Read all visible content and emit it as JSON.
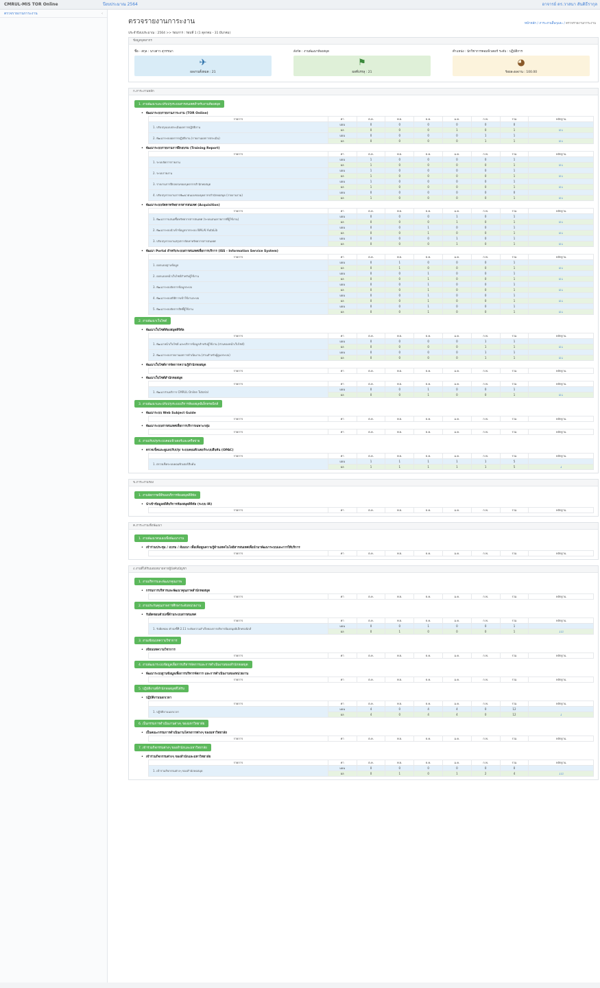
{
  "topbar": {
    "brand": "CMRUL-MIS TOR Online",
    "fiscal": "ปีงบประมาณ 2564",
    "user": "อาจารย์ ดร.วาสนา สันติธีรากุล"
  },
  "sidebar": {
    "item": "ตรวจรายงานการะงาน",
    "chevron": "‹"
  },
  "page": {
    "title": "ตรวจรายงานการะงาน",
    "crumb_home": "หน้าหลัก",
    "crumb_mid": "ภาระงานอื่นๆและ",
    "crumb_cur": "ตรวจรายงานการะงาน",
    "crumb_sep": "/"
  },
  "period": "ประจำปีงบประมาณ : 2564 >> รอบการ : รอบที่ 1 (1 ตุลาคม - 31 มีนาคม)",
  "info": {
    "header": "ข้อมูลบุคลากร",
    "name": "ชื่อ - สกุล : นางสาว สุวรรณา",
    "affiliation": "สังกัด : งานพัฒนาห้องสมุด",
    "position": "ตำแหน่ง : นักวิชาการคอมพิวเตอร์ ระดับ : ปฏิบัติการ",
    "card1": "ผลงานทั้งหมด : 21",
    "card2": "ผลที่บรรลุ : 21",
    "card3": "ร้อยละผลงาน : 100.00",
    "ic1": "✈",
    "ic2": "⚑",
    "ic3": "◕"
  },
  "cols": [
    "รายการ",
    "ค่า",
    "ต.ค.",
    "พ.ย.",
    "ธ.ค.",
    "ม.ค.",
    "ก.พ.",
    "รวม",
    "หลักฐาน"
  ],
  "row_types": {
    "plan": "แผน",
    "result": "ผล"
  },
  "groups": [
    {
      "header": "ก.ภาระงานหลัก",
      "categories": [
        {
          "title": "1. งานพัฒนาและปรับปรุงระบบสารสนเทศสำหรับงานห้องสมุด",
          "sections": [
            {
              "title": "พัฒนาระบบรายงานภาระงาน (TOR Online)",
              "items": [
                {
                  "label": "1. ปรับปรุงแบบประเมินผลการปฏิบัติงาน",
                  "plan": [
                    "0",
                    "0",
                    "0",
                    "0",
                    "0",
                    "0"
                  ],
                  "result": [
                    "0",
                    "0",
                    "0",
                    "1",
                    "0",
                    "1"
                  ],
                  "ev": "☑↓"
                },
                {
                  "label": "2. พัฒนาระบบผลการปฏิบัติงาน (รายงานผลการประเมิน)",
                  "plan": [
                    "0",
                    "0",
                    "0",
                    "0",
                    "1",
                    "1"
                  ],
                  "result": [
                    "0",
                    "0",
                    "0",
                    "0",
                    "1",
                    "1"
                  ],
                  "ev": "☑↓"
                }
              ]
            },
            {
              "title": "พัฒนาระบบรายงานการฝึกอบรม (Training Report)",
              "items": [
                {
                  "label": "1. ระบบจัดการรายงาน",
                  "plan": [
                    "1",
                    "0",
                    "0",
                    "0",
                    "0",
                    "1"
                  ],
                  "result": [
                    "1",
                    "0",
                    "0",
                    "0",
                    "0",
                    "1"
                  ],
                  "ev": "☑↓"
                },
                {
                  "label": "2. ระบบรายงาน",
                  "plan": [
                    "1",
                    "0",
                    "0",
                    "0",
                    "0",
                    "1"
                  ],
                  "result": [
                    "1",
                    "0",
                    "0",
                    "0",
                    "0",
                    "1"
                  ],
                  "ev": "☑↓"
                },
                {
                  "label": "3. รายงานการฝึกอบรมของบุคลากรสำนักหอสมุด",
                  "plan": [
                    "1",
                    "0",
                    "0",
                    "0",
                    "0",
                    "1"
                  ],
                  "result": [
                    "1",
                    "0",
                    "0",
                    "0",
                    "0",
                    "1"
                  ],
                  "ev": "☑↓"
                },
                {
                  "label": "4. ปรับปรุงรายงานการพัฒนาตนเองของบุคลากรสำนักหอสมุด (รายงานรวม)",
                  "plan": [
                    "0",
                    "0",
                    "0",
                    "0",
                    "0",
                    "0"
                  ],
                  "result": [
                    "1",
                    "0",
                    "0",
                    "0",
                    "0",
                    "1"
                  ],
                  "ev": "☑↓"
                }
              ]
            },
            {
              "title": "พัฒนาระบบจัดหาทรัพยากรสารสนเทศ (Acquisition)",
              "items": [
                {
                  "label": "1. พัฒนาการเสนอซื้อทรัพยากรสารสนเทศ (ระบบเสนอรายการที่ผู้ใช้งาน)",
                  "plan": [
                    "0",
                    "0",
                    "0",
                    "1",
                    "0",
                    "1"
                  ],
                  "result": [
                    "0",
                    "0",
                    "0",
                    "1",
                    "0",
                    "1"
                  ],
                  "ev": "☑↓"
                },
                {
                  "label": "2. พัฒนาระบบนำเข้าข้อมูลจากระบบ WALAI AutoLib",
                  "plan": [
                    "0",
                    "0",
                    "1",
                    "0",
                    "0",
                    "1"
                  ],
                  "result": [
                    "0",
                    "0",
                    "1",
                    "0",
                    "0",
                    "1"
                  ],
                  "ev": "☑↓"
                },
                {
                  "label": "3. ปรับปรุงรายงานสรุปการจัดหาทรัพยากรสารสนเทศ",
                  "plan": [
                    "0",
                    "0",
                    "0",
                    "1",
                    "0",
                    "1"
                  ],
                  "result": [
                    "0",
                    "0",
                    "0",
                    "1",
                    "0",
                    "1"
                  ],
                  "ev": "☑↓"
                }
              ]
            },
            {
              "title": "พัฒนา Portal สำหรับระบบสารสนเทศเพื่อการบริการ (ISS - Information Service System)",
              "items": [
                {
                  "label": "1. ออกแบบฐานข้อมูล",
                  "plan": [
                    "0",
                    "1",
                    "0",
                    "0",
                    "0",
                    "1"
                  ],
                  "result": [
                    "0",
                    "1",
                    "0",
                    "0",
                    "0",
                    "1"
                  ],
                  "ev": "☑↓"
                },
                {
                  "label": "2. ออกแบบหน้าเว็บไซต์สำหรับผู้ใช้งาน",
                  "plan": [
                    "0",
                    "0",
                    "1",
                    "0",
                    "0",
                    "1"
                  ],
                  "result": [
                    "0",
                    "0",
                    "1",
                    "0",
                    "0",
                    "1"
                  ],
                  "ev": "☑↓"
                },
                {
                  "label": "3. พัฒนาระบบจัดการข้อมูลระบบ",
                  "plan": [
                    "0",
                    "0",
                    "1",
                    "0",
                    "0",
                    "1"
                  ],
                  "result": [
                    "0",
                    "0",
                    "1",
                    "0",
                    "0",
                    "1"
                  ],
                  "ev": "☑↓"
                },
                {
                  "label": "4. พัฒนาระบบสถิติการเข้าใช้งานระบบ",
                  "plan": [
                    "0",
                    "0",
                    "1",
                    "0",
                    "0",
                    "1"
                  ],
                  "result": [
                    "0",
                    "0",
                    "1",
                    "0",
                    "0",
                    "1"
                  ],
                  "ev": "☑↓"
                },
                {
                  "label": "5. พัฒนาระบบจัดการสิทธิ์ผู้ใช้งาน",
                  "plan": [
                    "0",
                    "0",
                    "1",
                    "0",
                    "0",
                    "1"
                  ],
                  "result": [
                    "0",
                    "0",
                    "1",
                    "0",
                    "0",
                    "1"
                  ],
                  "ev": "☑↓"
                }
              ]
            }
          ]
        },
        {
          "title": "2. งานพัฒนาเว็บไซต์",
          "sections": [
            {
              "title": "พัฒนาเว็บไซต์ห้องสมุดดิจิทัล",
              "items": [
                {
                  "label": "1. พัฒนาหน้าเว็บไซต์ และบริการข้อมูลสำหรับผู้ใช้งาน (ส่วนของหน้าเว็บไซต์)",
                  "plan": [
                    "0",
                    "0",
                    "0",
                    "0",
                    "1",
                    "1"
                  ],
                  "result": [
                    "0",
                    "0",
                    "0",
                    "0",
                    "1",
                    "1"
                  ],
                  "ev": "☑↓"
                },
                {
                  "label": "2. พัฒนาระบบรายงานผลการดำเนินงาน (ส่วนสำหรับผู้ดูแลระบบ)",
                  "plan": [
                    "0",
                    "0",
                    "0",
                    "0",
                    "1",
                    "1"
                  ],
                  "result": [
                    "0",
                    "0",
                    "0",
                    "0",
                    "1",
                    "1"
                  ],
                  "ev": "☑↓"
                }
              ]
            },
            {
              "title": "พัฒนาเว็บไซต์การจัดการความรู้สำนักหอสมุด",
              "items": []
            },
            {
              "title": "พัฒนาเว็บไซต์สำนักหอสมุด",
              "items": [
                {
                  "label": "1. พัฒนาส่วนบริการ CMRUL Online Tutorial",
                  "plan": [
                    "0",
                    "0",
                    "1",
                    "0",
                    "0",
                    "1"
                  ],
                  "result": [
                    "0",
                    "0",
                    "1",
                    "0",
                    "0",
                    "1"
                  ],
                  "ev": "☑↓"
                }
              ]
            }
          ]
        },
        {
          "title": "3. งานพัฒนาและปรับปรุงระบบบริการห้องสมุดอิเล็กทรอนิกส์",
          "sections": [
            {
              "title": "พัฒนาระบบ Web Subject Guide",
              "items": []
            },
            {
              "title": "พัฒนาระบบสารสนเทศเพื่อการบริการเฉพาะกลุ่ม",
              "items": []
            }
          ]
        },
        {
          "title": "4. งานปรับปรุงระบบคอมพิวเตอร์และเครือข่าย",
          "sections": [
            {
              "title": "ตรวจเช็คและดูแลปรับปรุง ระบบคอมพิวเตอร์ระบบสืบค้น (OPAC)",
              "items": [
                {
                  "label": "1. ตรวจเช็คระบบคอมพิวเตอร์สืบค้น",
                  "plan": [
                    "1",
                    "1",
                    "1",
                    "1",
                    "1",
                    "5"
                  ],
                  "result": [
                    "1",
                    "1",
                    "1",
                    "1",
                    "1",
                    "5"
                  ],
                  "ev": "↓"
                }
              ]
            }
          ]
        }
      ]
    },
    {
      "header": "ข.ภาระงานรอง",
      "categories": [
        {
          "title": "1. งานจัดการสถิติของบริการห้องสมุดดิจิทัล",
          "sections": [
            {
              "title": "นำเข้าข้อมูลสถิติบริการห้องสมุดดิจิทัล (ระบบ IR)",
              "items": []
            }
          ]
        }
      ]
    },
    {
      "header": "ค.ภาระงานเชิงพัฒนา",
      "categories": [
        {
          "title": "1. งานพัฒนาตนเองเพื่อพัฒนางาน",
          "sections": [
            {
              "title": "เข้าร่วมประชุม / อบรม / สัมมนา เพื่อเพิ่มพูนความรู้ด้านเทคโนโลยีสารสนเทศเพื่อนำมาพัฒนาระบบและการให้บริการ",
              "items": []
            }
          ]
        }
      ]
    },
    {
      "header": "ง.งานที่ได้รับมอบหมายจากผู้บังคับบัญชา",
      "categories": [
        {
          "title": "1. งานบริหารและพัฒนาคุณภาพ",
          "sections": [
            {
              "title": "กรรมการบริหารและพัฒนาคุณภาพสำนักหอสมุด",
              "items": []
            }
          ]
        },
        {
          "title": "2. งานประกันคุณภาพการศึกษาระดับหน่วยงาน",
          "sections": [
            {
              "title": "รับผิดชอบตัวบ่งชี้ด้านระบบสารสนเทศ",
              "items": [
                {
                  "label": "1. รับผิดชอบ ตัวบ่งชี้ที่ 2.11 ระดับความสำเร็จของการบริหารห้องสมุดอิเล็กทรอนิกส์",
                  "plan": [
                    "0",
                    "0",
                    "1",
                    "0",
                    "0",
                    "1"
                  ],
                  "result": [
                    "0",
                    "1",
                    "0",
                    "0",
                    "0",
                    "1"
                  ],
                  "ev": "↓☑"
                }
              ]
            }
          ]
        },
        {
          "title": "3. งานเขียนบทความวิชาการ",
          "sections": [
            {
              "title": "เขียนบทความวิชาการ",
              "items": []
            }
          ]
        },
        {
          "title": "4. งานพัฒนาระบบข้อมูลเพื่อการบริหารจัดการและการดำเนินงานของสำนักหอสมุด",
          "sections": [
            {
              "title": "พัฒนาระบบฐานข้อมูลเพื่อการบริหารจัดการ และการดำเนินงานของหน่วยงาน",
              "items": []
            }
          ]
        },
        {
          "title": "5. ปฏิบัติงานที่สำนักหอสมุดที่ได้รับ",
          "sections": [
            {
              "title": "ปฏิบัติงานนอกเวลา",
              "items": [
                {
                  "label": "1. ปฏิบัติงานนอกเวลา",
                  "plan": [
                    "4",
                    "0",
                    "4",
                    "4",
                    "0",
                    "12"
                  ],
                  "result": [
                    "4",
                    "0",
                    "4",
                    "4",
                    "0",
                    "12"
                  ],
                  "ev": "↓"
                }
              ]
            }
          ]
        },
        {
          "title": "6. เป็นกรรมการดำเนินงานต่างๆ ของมหาวิทยาลัย",
          "sections": [
            {
              "title": "เป็นคณะกรรมการดำเนินงานโครงการต่างๆ ของมหาวิทยาลัย",
              "items": []
            }
          ]
        },
        {
          "title": "7. เข้าร่วมกิจกรรมต่างๆ ของสำนักและมหาวิทยาลัย",
          "sections": [
            {
              "title": "เข้าร่วมกิจกรรมต่างๆ ของสำนักและมหาวิทยาลัย",
              "items": [
                {
                  "label": "1. เข้าร่วมกิจกรรมต่างๆ ของสำนักหอสมุด",
                  "plan": [
                    "0",
                    "0",
                    "0",
                    "0",
                    "0",
                    "0"
                  ],
                  "result": [
                    "0",
                    "1",
                    "0",
                    "1",
                    "2",
                    "4"
                  ],
                  "ev": "↓☑"
                }
              ]
            }
          ]
        }
      ]
    }
  ]
}
